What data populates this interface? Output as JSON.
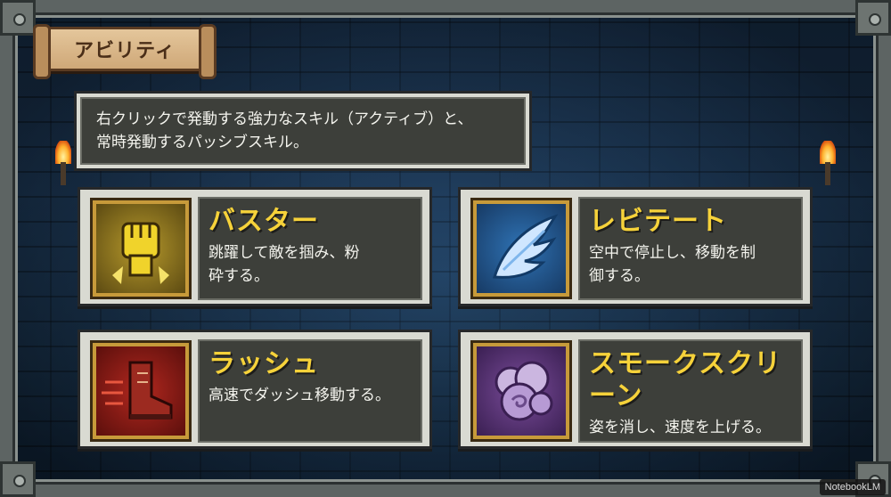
{
  "screen": {
    "title": "アビリティ",
    "description_line1": "右クリックで発動する強力なスキル（アクティブ）と、",
    "description_line2": "常時発動するパッシブスキル。"
  },
  "skills": [
    {
      "name": "バスター",
      "desc1": "跳躍して敵を掴み、粉",
      "desc2": "砕する。",
      "icon": "fist-icon",
      "color": "#b79a2c"
    },
    {
      "name": "レビテート",
      "desc1": "空中で停止し、移動を制",
      "desc2": "御する。",
      "icon": "wing-icon",
      "color": "#2f73b5"
    },
    {
      "name": "ラッシュ",
      "desc1": "高速でダッシュ移動する。",
      "desc2": "",
      "icon": "boot-icon",
      "color": "#b3281f"
    },
    {
      "name": "スモークスクリーン",
      "desc1": "姿を消し、速度を上げる。",
      "desc2": "",
      "icon": "smoke-icon",
      "color": "#7a4c9a"
    }
  ],
  "watermark": "NotebookLM",
  "colors": {
    "skill_name": "#f6d23a",
    "panel": "#3d3f3a",
    "frame": "#d9dad2"
  }
}
